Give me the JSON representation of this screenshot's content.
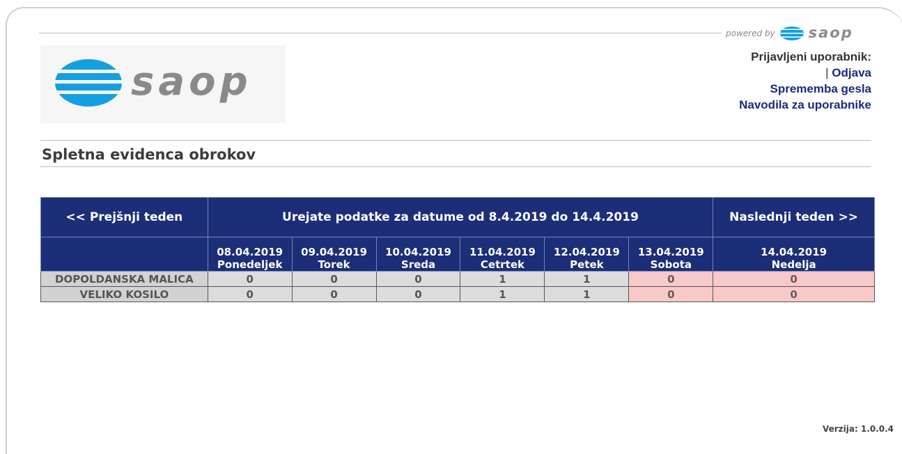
{
  "header": {
    "powered_by": "powered by",
    "brand": "saop",
    "logo_text": "saop"
  },
  "user_panel": {
    "logged_in_label": "Prijavljeni uporabnik:",
    "separator": "|",
    "logout": "Odjava",
    "change_password": "Sprememba gesla",
    "user_guide": "Navodila za uporabnike"
  },
  "page_title": "Spletna evidenca obrokov",
  "week_nav": {
    "prev": "<< Prejšnji teden",
    "range_text": "Urejate podatke za datume od 8.4.2019 do 14.4.2019",
    "next": "Naslednji teden >>"
  },
  "days": [
    {
      "date": "08.04.2019",
      "name": "Ponedeljek",
      "weekend": false
    },
    {
      "date": "09.04.2019",
      "name": "Torek",
      "weekend": false
    },
    {
      "date": "10.04.2019",
      "name": "Sreda",
      "weekend": false
    },
    {
      "date": "11.04.2019",
      "name": "Cetrtek",
      "weekend": false
    },
    {
      "date": "12.04.2019",
      "name": "Petek",
      "weekend": false
    },
    {
      "date": "13.04.2019",
      "name": "Sobota",
      "weekend": true
    },
    {
      "date": "14.04.2019",
      "name": "Nedelja",
      "weekend": true
    }
  ],
  "meals": [
    {
      "name": "DOPOLDANSKA MALICA",
      "values": [
        "0",
        "0",
        "0",
        "1",
        "1",
        "0",
        "0"
      ]
    },
    {
      "name": "VELIKO KOSILO",
      "values": [
        "0",
        "0",
        "0",
        "1",
        "1",
        "0",
        "0"
      ]
    }
  ],
  "version": "Verzija: 1.0.0.4",
  "colors": {
    "header_blue": "#1c2e78",
    "weekend_pink": "#f7c9c9",
    "brand_blue": "#14a0e0",
    "link_blue": "#1a2b7a"
  }
}
